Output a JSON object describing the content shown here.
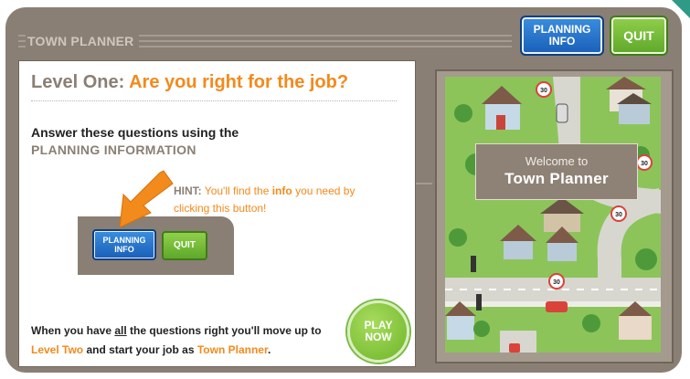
{
  "header": {
    "title": "TOWN PLANNER",
    "planning_info_line1": "PLANNING",
    "planning_info_line2": "INFO",
    "quit_label": "QUIT"
  },
  "level": {
    "prefix": "Level One:",
    "question": "Are you right for the job?"
  },
  "instructions": {
    "line1": "Answer these questions using the",
    "line2": "PLANNING INFORMATION"
  },
  "hint": {
    "label": "HINT:",
    "text_before": "You'll find the",
    "info_word": "info",
    "text_after": "you need by clicking this button!"
  },
  "mini_buttons": {
    "planning_line1": "PLANNING",
    "planning_line2": "INFO",
    "quit": "QUIT"
  },
  "bottom": {
    "part1": "When you have",
    "all_word": "all",
    "part2": "the questions right you'll move up to",
    "level_two": "Level Two",
    "part3": "and start your job as",
    "town_planner": "Town Planner",
    "end": "."
  },
  "play": {
    "line1": "PLAY",
    "line2": "NOW"
  },
  "map": {
    "welcome_line1": "Welcome to",
    "welcome_line2": "Town Planner",
    "speed_sign_1": "30",
    "speed_sign_2": "30",
    "speed_sign_3": "30",
    "speed_sign_4": "30"
  },
  "colors": {
    "frame": "#8a7f74",
    "accent_orange": "#f28a1c",
    "planning_blue": "#1a5fb8",
    "quit_green": "#5fa82a"
  }
}
